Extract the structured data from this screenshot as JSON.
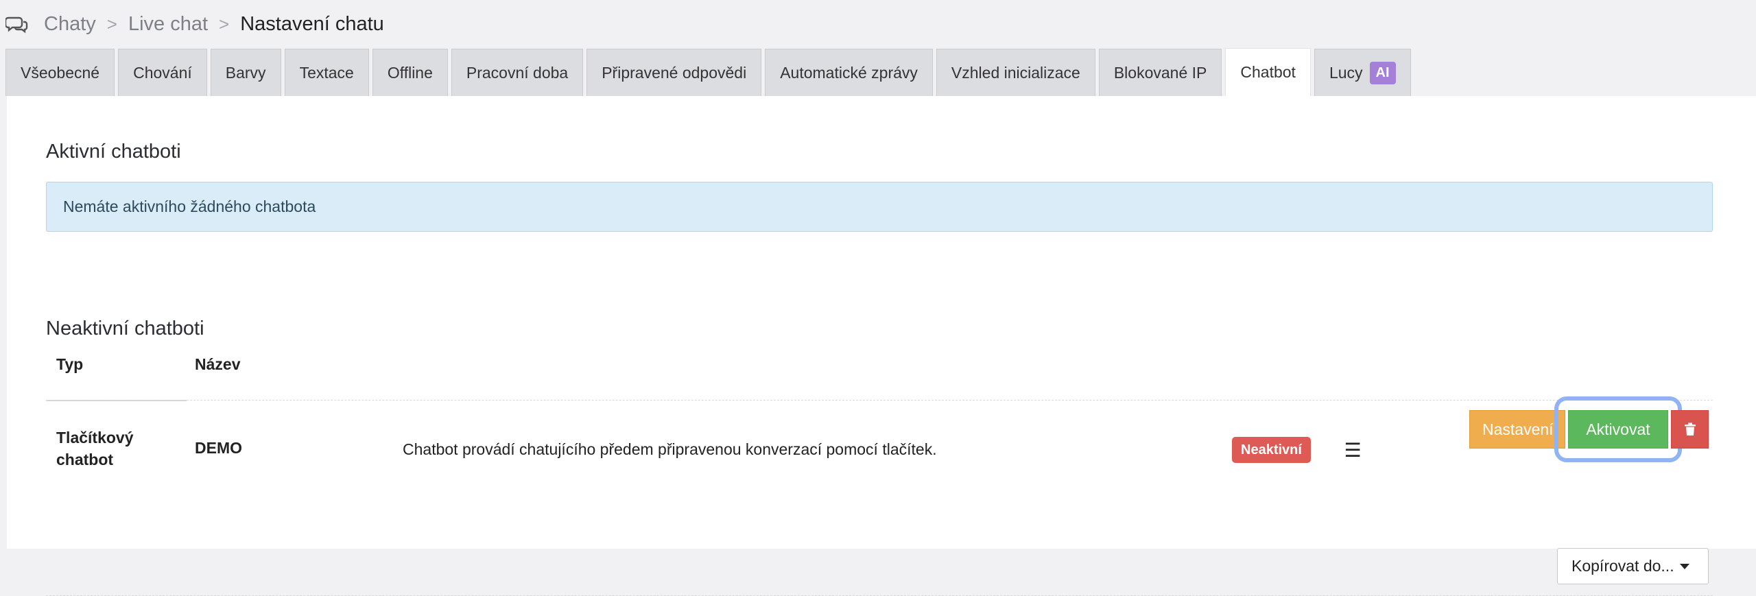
{
  "breadcrumb": {
    "items": [
      "Chaty",
      "Live chat"
    ],
    "separator": ">",
    "current": "Nastavení chatu",
    "icon": "chat-bubbles-icon"
  },
  "tabs": [
    {
      "label": "Všeobecné",
      "active": false
    },
    {
      "label": "Chování",
      "active": false
    },
    {
      "label": "Barvy",
      "active": false
    },
    {
      "label": "Textace",
      "active": false
    },
    {
      "label": "Offline",
      "active": false
    },
    {
      "label": "Pracovní doba",
      "active": false
    },
    {
      "label": "Připravené odpovědi",
      "active": false
    },
    {
      "label": "Automatické zprávy",
      "active": false
    },
    {
      "label": "Vzhled inicializace",
      "active": false
    },
    {
      "label": "Blokované IP",
      "active": false
    },
    {
      "label": "Chatbot",
      "active": true
    },
    {
      "label": "Lucy",
      "active": false,
      "badge": "AI"
    }
  ],
  "active_section": {
    "title": "Aktivní chatboti",
    "empty_message": "Nemáte aktivního žádného chatbota"
  },
  "inactive_section": {
    "title": "Neaktivní chatboti",
    "columns": {
      "type": "Typ",
      "name": "Název"
    },
    "rows": [
      {
        "type": "Tlačítkový chatbot",
        "name": "DEMO",
        "description": "Chatbot provádí chatujícího předem připravenou konverzací pomocí tlačítek.",
        "status": "Neaktivní",
        "settings_label": "Nastavení",
        "activate_label": "Aktivovat",
        "copy_label": "Kopírovat do..."
      }
    ]
  },
  "colors": {
    "settings": "#f0ad4e",
    "activate": "#5cb85c",
    "delete": "#d9534f",
    "status_inactive": "#de5a55",
    "ai_badge": "#a480d9",
    "alert_bg": "#d9ecf7"
  }
}
